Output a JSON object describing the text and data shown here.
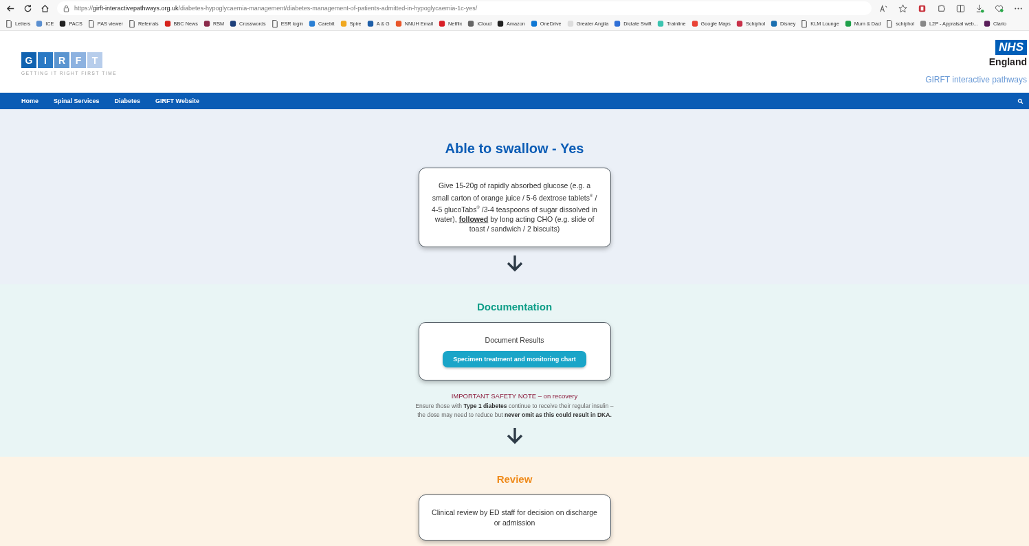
{
  "browser": {
    "url_prefix": "https://",
    "url_domain": "girft-interactivepathways.org.uk",
    "url_path": "/diabetes-hypoglycaemia-management/diabetes-management-of-patients-admitted-in-hypoglycaemia-1c-yes/"
  },
  "bookmarks": [
    {
      "label": "Letters",
      "kind": "page"
    },
    {
      "label": "ICE",
      "kind": "site",
      "color": "#5a8fd0"
    },
    {
      "label": "PACS",
      "kind": "site",
      "color": "#222222"
    },
    {
      "label": "PAS viewer",
      "kind": "page"
    },
    {
      "label": "Referrals",
      "kind": "page"
    },
    {
      "label": "BBC News",
      "kind": "site",
      "color": "#d6221b"
    },
    {
      "label": "RSM",
      "kind": "site",
      "color": "#8a2a4a"
    },
    {
      "label": "Crosswords",
      "kind": "site",
      "color": "#1d3f7a"
    },
    {
      "label": "ESR login",
      "kind": "page"
    },
    {
      "label": "Carebit",
      "kind": "site",
      "color": "#2a7fd4"
    },
    {
      "label": "Spire",
      "kind": "site",
      "color": "#f0a820"
    },
    {
      "label": "A & G",
      "kind": "site",
      "color": "#1f5fa8"
    },
    {
      "label": "NNUH Email",
      "kind": "site",
      "color": "#e8562a"
    },
    {
      "label": "Netflix",
      "kind": "site",
      "color": "#d81f26"
    },
    {
      "label": "iCloud",
      "kind": "site",
      "color": "#666666"
    },
    {
      "label": "Amazon",
      "kind": "site",
      "color": "#222222"
    },
    {
      "label": "OneDrive",
      "kind": "site",
      "color": "#0f78d4"
    },
    {
      "label": "Greater Anglia",
      "kind": "site",
      "color": "#dddddd"
    },
    {
      "label": "Dictate Swift",
      "kind": "site",
      "color": "#2f6fd6"
    },
    {
      "label": "Trainline",
      "kind": "site",
      "color": "#3cc4b0"
    },
    {
      "label": "Google Maps",
      "kind": "site",
      "color": "#e94235"
    },
    {
      "label": "Schiphol",
      "kind": "site",
      "color": "#c8324a"
    },
    {
      "label": "Disney",
      "kind": "site",
      "color": "#1a6fb0"
    },
    {
      "label": "KLM Lounge",
      "kind": "page"
    },
    {
      "label": "Mum & Dad",
      "kind": "site",
      "color": "#1fa04a"
    },
    {
      "label": "schiphol",
      "kind": "page"
    },
    {
      "label": "L2P - Appraisal web...",
      "kind": "site",
      "color": "#888888"
    },
    {
      "label": "Clario",
      "kind": "site",
      "color": "#5a1f5a"
    }
  ],
  "header": {
    "logo_letters": [
      "G",
      "I",
      "R",
      "F",
      "T"
    ],
    "logo_tagline": "GETTING IT RIGHT FIRST TIME",
    "nhs_mark": "NHS",
    "nhs_region": "England",
    "site_title": "GIRFT interactive pathways"
  },
  "nav": [
    {
      "label": "Home"
    },
    {
      "label": "Spinal Services"
    },
    {
      "label": "Diabetes"
    },
    {
      "label": "GIRFT Website"
    }
  ],
  "sections": [
    {
      "kind": "blue",
      "title": "Able to swallow - Yes",
      "box_text": "Give 15-20g of rapidly absorbed glucose (e.g. a small carton of orange juice / 5-6 dextrose tablets$^{®}$ / 4-5 glucoTabs$^{®}$ /3-4 teaspoons of sugar dissolved in water), **followed** by long acting CHO (e.g. slide of toast / sandwich / 2 biscuits)"
    },
    {
      "kind": "teal",
      "title": "Documentation",
      "box_text": "Document Results",
      "button": "Specimen treatment and monitoring chart",
      "note_title": "IMPORTANT SAFETY NOTE – on recovery",
      "note_text": "Ensure those with **Type 1 diabetes** continue to receive their regular insulin – the dose may need to reduce but **never omit as this could result in DKA.**"
    },
    {
      "kind": "orange",
      "title": "Review",
      "box_text": "Clinical review by ED staff for decision on discharge or admission"
    }
  ]
}
